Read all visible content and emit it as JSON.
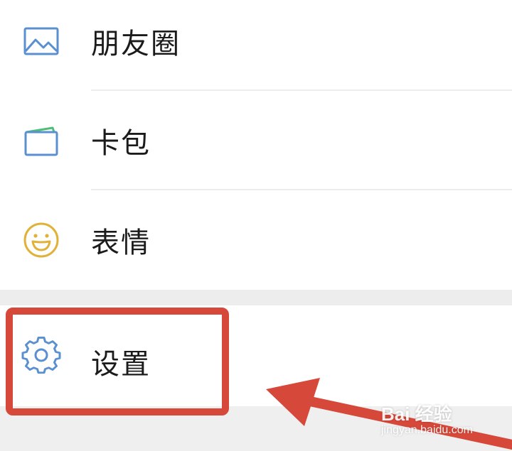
{
  "menu": {
    "items": [
      {
        "label": "朋友圈",
        "icon": "image-icon",
        "color": "#5a8fd0"
      },
      {
        "label": "卡包",
        "icon": "wallet-icon",
        "color": "#5a8fd0",
        "accent": "#4cbf73"
      },
      {
        "label": "表情",
        "icon": "smiley-icon",
        "color": "#e0b23a"
      }
    ],
    "settings": {
      "label": "设置",
      "icon": "gear-icon",
      "color": "#5a8fd0"
    }
  },
  "annotation": {
    "highlight_color": "#d6483a",
    "arrow_color": "#d6483a"
  },
  "watermark": {
    "brand": "Bai 经验",
    "url": "jingyan.baidu.com"
  }
}
